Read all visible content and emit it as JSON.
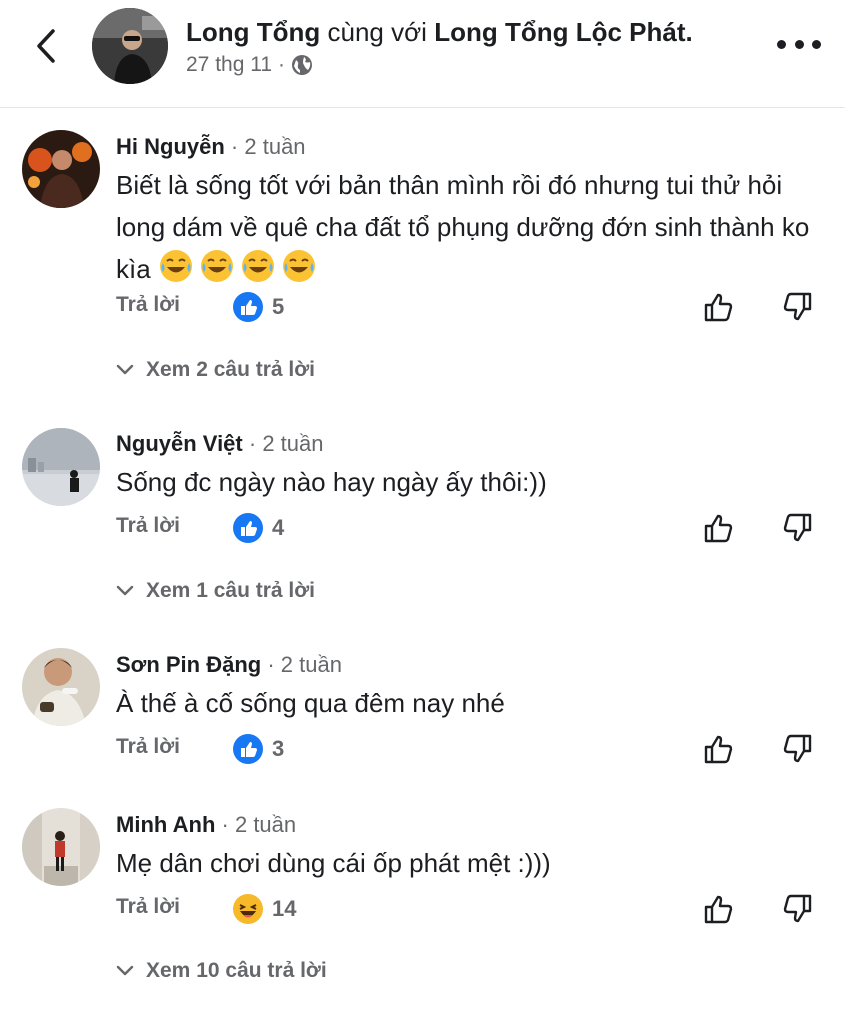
{
  "header": {
    "author": "Long Tổng",
    "with_text": "cùng với",
    "tagged": "Long Tổng Lộc Phát.",
    "date": "27 thg 11",
    "separator": "·"
  },
  "comments": [
    {
      "name": "Hi Nguyễn",
      "time": "2 tuần",
      "text": "Biết là sống tốt với bản thân mình rồi đó nhưng tui thử hỏi long dám về quê cha đất tổ phụng dưỡng đớn sinh thành ko kìa",
      "emojis": [
        "laughing-tears-emoji",
        "laughing-tears-emoji",
        "laughing-tears-emoji",
        "laughing-tears-emoji"
      ],
      "reply_label": "Trả lời",
      "reaction": "like",
      "reaction_count": "5",
      "view_replies": "Xem 2 câu trả lời"
    },
    {
      "name": "Nguyễn Việt",
      "time": "2 tuần",
      "text": "Sống đc ngày nào hay ngày ấy thôi:))",
      "reply_label": "Trả lời",
      "reaction": "like",
      "reaction_count": "4",
      "view_replies": "Xem 1 câu trả lời"
    },
    {
      "name": "Sơn Pin Đặng",
      "time": "2 tuần",
      "text": "À thế à cố sống qua đêm nay nhé",
      "reply_label": "Trả lời",
      "reaction": "like",
      "reaction_count": "3"
    },
    {
      "name": "Minh Anh",
      "time": "2 tuần",
      "text": "Mẹ dân chơi dùng cái ốp phát mệt :)))",
      "reply_label": "Trả lời",
      "reaction": "haha",
      "reaction_count": "14",
      "view_replies": "Xem 10 câu trả lời"
    }
  ],
  "colors": {
    "like_blue": "#1877f2",
    "secondary_text": "#65676b",
    "haha_yellow": "#f7b928"
  }
}
